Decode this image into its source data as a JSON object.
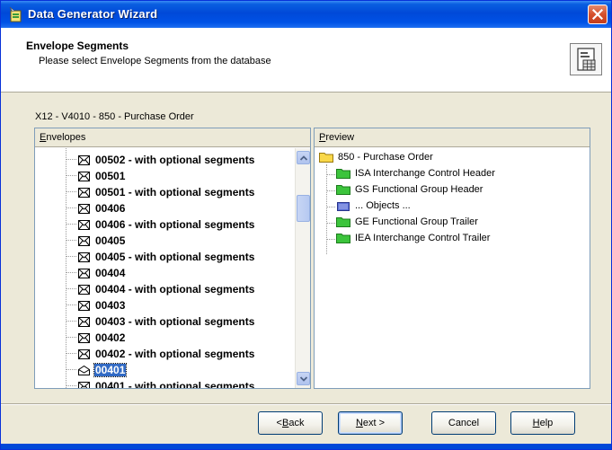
{
  "window": {
    "title": "Data Generator Wizard",
    "icon": "wizard-app-icon",
    "colors": {
      "titlebar": "#0052e6",
      "close": "#d6502c",
      "selection": "#316ac5",
      "face": "#ece9d8"
    }
  },
  "header": {
    "title": "Envelope Segments",
    "subtitle": "Please select Envelope Segments from the database",
    "icon": "document-grid-icon"
  },
  "path_label": "X12 - V4010 - 850 - Purchase Order",
  "envelopes": {
    "label_prefix": "",
    "label_accel": "E",
    "label_rest": "nvelopes",
    "items": [
      {
        "label": "00502 - with optional segments",
        "selected": false
      },
      {
        "label": "00501",
        "selected": false
      },
      {
        "label": "00501 - with optional segments",
        "selected": false
      },
      {
        "label": "00406",
        "selected": false
      },
      {
        "label": "00406 - with optional segments",
        "selected": false
      },
      {
        "label": "00405",
        "selected": false
      },
      {
        "label": "00405 - with optional segments",
        "selected": false
      },
      {
        "label": "00404",
        "selected": false
      },
      {
        "label": "00404 - with optional segments",
        "selected": false
      },
      {
        "label": "00403",
        "selected": false
      },
      {
        "label": "00403 - with optional segments",
        "selected": false
      },
      {
        "label": "00402",
        "selected": false
      },
      {
        "label": "00402 - with optional segments",
        "selected": false
      },
      {
        "label": "00401",
        "selected": true
      },
      {
        "label": "00401 - with optional segments",
        "selected": false
      }
    ]
  },
  "preview": {
    "label_accel": "P",
    "label_rest": "review",
    "root": {
      "label": "850 - Purchase Order",
      "icon": "yellow-folder-icon"
    },
    "children": [
      {
        "label": "ISA  Interchange Control Header",
        "icon": "green-folder-icon"
      },
      {
        "label": "GS  Functional Group Header",
        "icon": "green-folder-icon"
      },
      {
        "label": "... Objects ...",
        "icon": "blue-folder-icon"
      },
      {
        "label": "GE  Functional Group Trailer",
        "icon": "green-folder-icon"
      },
      {
        "label": "IEA  Interchange Control Trailer",
        "icon": "green-folder-icon"
      }
    ]
  },
  "buttons": {
    "back": {
      "pre": "< ",
      "accel": "B",
      "post": "ack"
    },
    "next": {
      "pre": "",
      "accel": "N",
      "post": "ext >"
    },
    "cancel": {
      "label": "Cancel"
    },
    "help": {
      "pre": "",
      "accel": "H",
      "post": "elp"
    }
  }
}
